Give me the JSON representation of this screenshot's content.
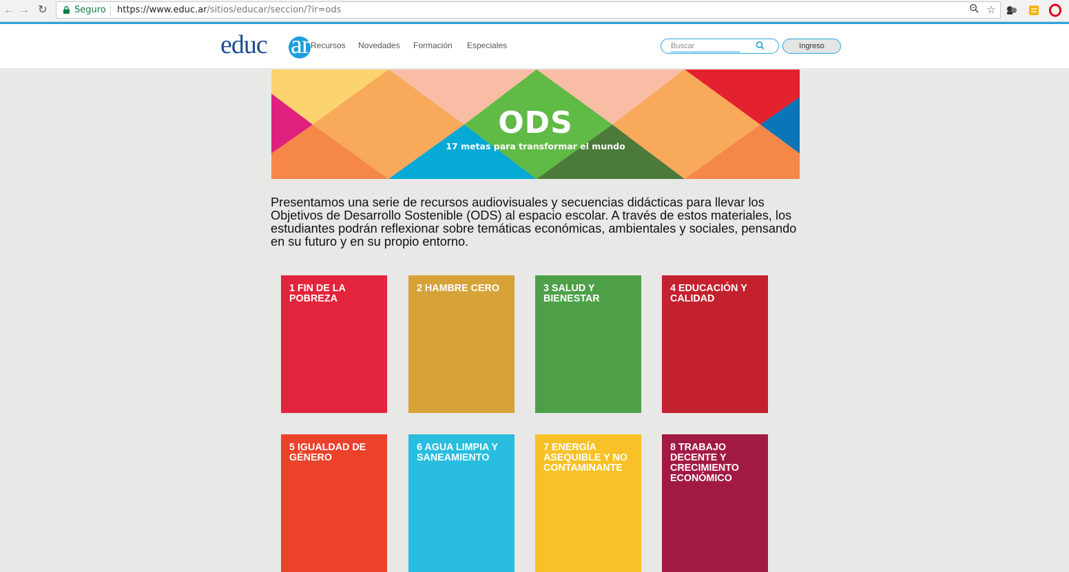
{
  "browser": {
    "secure_label": "Seguro",
    "url_host": "https://www.educ.ar",
    "url_path": "/sitios/educar/seccion/?ir=ods"
  },
  "header": {
    "logo_main": "educ",
    "logo_accent": "ar",
    "nav": [
      "Recursos",
      "Novedades",
      "Formación",
      "Especiales"
    ],
    "search_placeholder": "Buscar",
    "login_label": "Ingreso"
  },
  "banner": {
    "title": "ODS",
    "subtitle": "17 metas para transformar el mundo"
  },
  "intro": {
    "text": "Presentamos una serie de recursos audiovisuales y secuencias didácticas para llevar los Objetivos de Desarrollo Sostenible (ODS) al espacio escolar. A través de estos materiales, los estudiantes podrán reflexionar sobre temáticas económicas, ambientales y sociales, pensando en su futuro y en su propio entorno."
  },
  "goals": [
    {
      "label": "1 FIN DE LA POBREZA",
      "color": "#e2253c"
    },
    {
      "label": "2 HAMBRE CERO",
      "color": "#d7a339"
    },
    {
      "label": "3 SALUD Y BIENESTAR",
      "color": "#4da048"
    },
    {
      "label": "4 EDUCACIÓN Y CALIDAD",
      "color": "#c4212f"
    },
    {
      "label": "5 IGUALDAD DE GÉNERO",
      "color": "#ec412b"
    },
    {
      "label": "6 AGUA LIMPIA Y SANEAMIENTO",
      "color": "#29bde0"
    },
    {
      "label": "7 ENERGÍA ASEQUIBLE Y NO CONTAMINANTE",
      "color": "#f7c127"
    },
    {
      "label": "8 TRABAJO DECENTE Y CRECIMIENTO ECONÓMICO",
      "color": "#a21a43"
    }
  ],
  "colors": {
    "accent": "#2aa6df",
    "logo_blue": "#1d4b8f",
    "background": "#e8e8e7"
  }
}
